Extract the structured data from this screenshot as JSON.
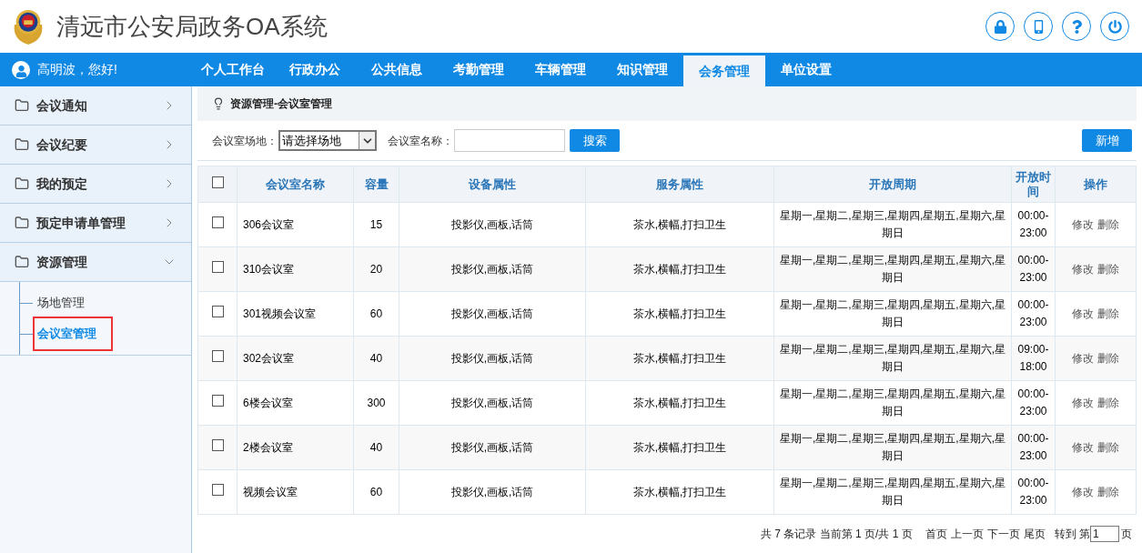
{
  "header": {
    "title": "清远市公安局政务OA系统"
  },
  "user": {
    "greeting": "高明波，您好!"
  },
  "nav": {
    "tabs": [
      {
        "label": "个人工作台",
        "selected": false
      },
      {
        "label": "行政办公",
        "selected": false
      },
      {
        "label": "公共信息",
        "selected": false
      },
      {
        "label": "考勤管理",
        "selected": false
      },
      {
        "label": "车辆管理",
        "selected": false
      },
      {
        "label": "知识管理",
        "selected": false
      },
      {
        "label": "会务管理",
        "selected": true
      },
      {
        "label": "单位设置",
        "selected": false
      }
    ]
  },
  "sidebar": {
    "items": [
      {
        "label": "会议通知",
        "expanded": false
      },
      {
        "label": "会议纪要",
        "expanded": false
      },
      {
        "label": "我的预定",
        "expanded": false
      },
      {
        "label": "预定申请单管理",
        "expanded": false
      },
      {
        "label": "资源管理",
        "expanded": true,
        "children": [
          {
            "label": "场地管理",
            "selected": false
          },
          {
            "label": "会议室管理",
            "selected": true
          }
        ]
      }
    ]
  },
  "breadcrumb": "资源管理-会议室管理",
  "filter": {
    "venue_label": "会议室场地：",
    "venue_select": "请选择场地",
    "name_label": "会议室名称：",
    "search_button": "搜索",
    "add_button": "新增"
  },
  "table": {
    "header_checked": false,
    "columns": [
      "会议室名称",
      "容量",
      "设备属性",
      "服务属性",
      "开放周期",
      "开放时间",
      "操作"
    ],
    "rows": [
      {
        "checked": false,
        "name": "306会议室",
        "capacity": "15",
        "equipment": "投影仪,画板,话筒",
        "service": "茶水,横幅,打扫卫生",
        "period": "星期一,星期二,星期三,星期四,星期五,星期六,星期日",
        "time": "00:00-23:00",
        "actions": [
          "修改",
          "删除"
        ]
      },
      {
        "checked": false,
        "name": "310会议室",
        "capacity": "20",
        "equipment": "投影仪,画板,话筒",
        "service": "茶水,横幅,打扫卫生",
        "period": "星期一,星期二,星期三,星期四,星期五,星期六,星期日",
        "time": "00:00-23:00",
        "actions": [
          "修改",
          "删除"
        ]
      },
      {
        "checked": false,
        "name": "301视频会议室",
        "capacity": "60",
        "equipment": "投影仪,画板,话筒",
        "service": "茶水,横幅,打扫卫生",
        "period": "星期一,星期二,星期三,星期四,星期五,星期六,星期日",
        "time": "00:00-23:00",
        "actions": [
          "修改",
          "删除"
        ]
      },
      {
        "checked": false,
        "name": "302会议室",
        "capacity": "40",
        "equipment": "投影仪,画板,话筒",
        "service": "茶水,横幅,打扫卫生",
        "period": "星期一,星期二,星期三,星期四,星期五,星期六,星期日",
        "time": "09:00-18:00",
        "actions": [
          "修改",
          "删除"
        ]
      },
      {
        "checked": false,
        "name": "6楼会议室",
        "capacity": "300",
        "equipment": "投影仪,画板,话筒",
        "service": "茶水,横幅,打扫卫生",
        "period": "星期一,星期二,星期三,星期四,星期五,星期六,星期日",
        "time": "00:00-23:00",
        "actions": [
          "修改",
          "删除"
        ]
      },
      {
        "checked": false,
        "name": "2楼会议室",
        "capacity": "40",
        "equipment": "投影仪,画板,话筒",
        "service": "茶水,横幅,打扫卫生",
        "period": "星期一,星期二,星期三,星期四,星期五,星期六,星期日",
        "time": "00:00-23:00",
        "actions": [
          "修改",
          "删除"
        ]
      },
      {
        "checked": false,
        "name": "视频会议室",
        "capacity": "60",
        "equipment": "投影仪,画板,话筒",
        "service": "茶水,横幅,打扫卫生",
        "period": "星期一,星期二,星期三,星期四,星期五,星期六,星期日",
        "time": "00:00-23:00",
        "actions": [
          "修改",
          "删除"
        ]
      }
    ]
  },
  "pagination": {
    "summary": "共 7 条记录 当前第 1 页/共 1 页",
    "links": [
      "首页",
      "上一页",
      "下一页",
      "尾页"
    ],
    "goto_label": "转到 第",
    "page_value": "1",
    "page_suffix": "页"
  }
}
